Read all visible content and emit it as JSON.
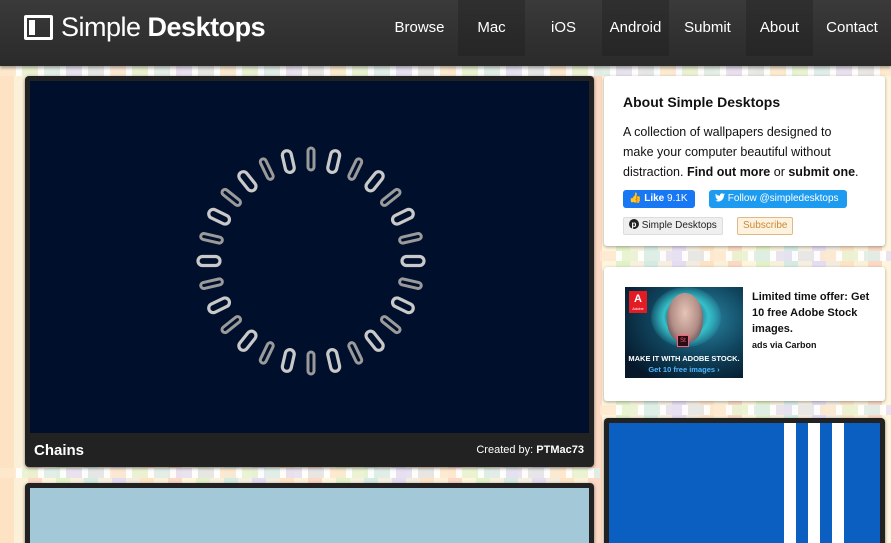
{
  "header": {
    "logo_light": "Simple",
    "logo_bold": "Desktops",
    "nav": [
      {
        "label": "Browse"
      },
      {
        "label": "Mac"
      },
      {
        "label": "iOS"
      },
      {
        "label": "Android"
      },
      {
        "label": "Submit"
      },
      {
        "label": "About"
      },
      {
        "label": "Contact"
      }
    ]
  },
  "posts": [
    {
      "title": "Chains",
      "credit_prefix": "Created by:",
      "credit_author": "PTMac73",
      "bg_color": "#000f2b"
    },
    {
      "bg_color": "#a3c8d8"
    }
  ],
  "about": {
    "title": "About Simple Desktops",
    "text_1": "A collection of wallpapers designed to make your computer beautiful without distraction.",
    "link_find": "Find out more",
    "or": "or",
    "link_submit": "submit one",
    "period": ".",
    "like_label": "Like",
    "like_count": "9.1K",
    "follow_label": "Follow @simpledesktops",
    "pinterest_label": "Simple Desktops",
    "subscribe_label": "Subscribe"
  },
  "ad": {
    "logo_label": "A",
    "logo_sub": "Adobe",
    "st_label": "St",
    "image_line_1": "MAKE IT WITH ADOBE STOCK.",
    "image_line_2": "Get 10 free images ›",
    "text": "Limited time offer: Get 10 free Adobe Stock images.",
    "via": "ads via Carbon"
  },
  "colors": {
    "header": "#2e2e2e",
    "facebook": "#1877f2",
    "twitter": "#1d9bf0",
    "third_wallpaper": "#0a5fc0"
  }
}
